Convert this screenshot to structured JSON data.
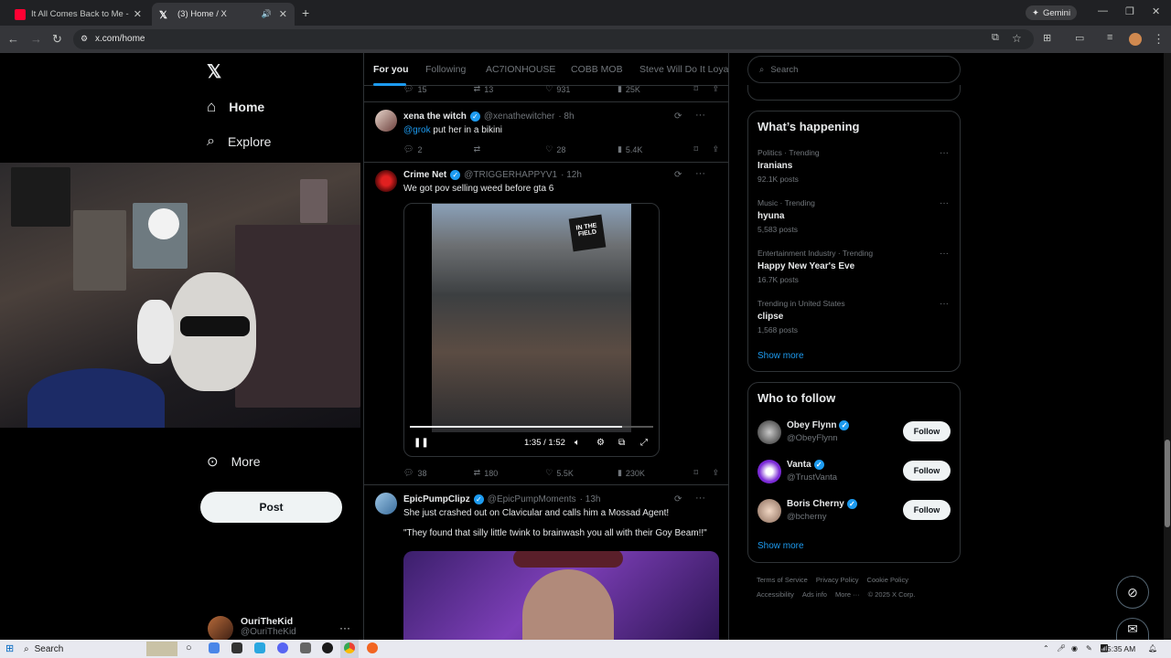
{
  "browser": {
    "tabs": [
      {
        "title": "It All Comes Back to Me - Baby",
        "icon": "youtube-icon"
      },
      {
        "title": "(3) Home / X",
        "icon": "x-icon"
      }
    ],
    "url": "x.com/home",
    "gemini_label": "Gemini"
  },
  "nav": {
    "home": "Home",
    "explore": "Explore",
    "more": "More",
    "post": "Post",
    "account_name": "OuriTheKid",
    "account_handle": "@OuriTheKid"
  },
  "feed": {
    "tabs": [
      "For you",
      "Following",
      "AC7IONHOUSE",
      "COBB MOB",
      "Steve Will Do It Loyal"
    ],
    "top_actions": {
      "replies": "15",
      "reposts": "13",
      "likes": "931",
      "views": "25K"
    },
    "tweets": [
      {
        "name": "xena the witch",
        "handle": "@xenathewitcher",
        "time": "· 8h",
        "mention": "@grok",
        "text": "put her in a bikini",
        "replies": "2",
        "reposts": "",
        "likes": "28",
        "views": "5.4K"
      },
      {
        "name": "Crime Net",
        "handle": "@TRIGGERHAPPYV1",
        "time": "· 12h",
        "text": "We got pov selling weed before gta 6",
        "video_time": "1:35 / 1:52",
        "video_badge_line1": "IN THE",
        "video_badge_line2": "FIELD",
        "replies": "38",
        "reposts": "180",
        "likes": "5.5K",
        "views": "230K"
      },
      {
        "name": "EpicPumpClipz",
        "handle": "@EpicPumpMoments",
        "time": "· 13h",
        "text": "She just crashed out on Clavicular and calls him a Mossad Agent!",
        "text2": "\"They found that silly little twink to brainwash you all with their Goy Beam!!\""
      }
    ]
  },
  "sidebar": {
    "search_placeholder": "Search",
    "whats_happening": "What’s happening",
    "trends": [
      {
        "meta": "Politics · Trending",
        "title": "Iranians",
        "count": "92.1K posts"
      },
      {
        "meta": "Music · Trending",
        "title": "hyuna",
        "count": "5,583 posts"
      },
      {
        "meta": "Entertainment Industry · Trending",
        "title": "Happy New Year's Eve",
        "count": "16.7K posts"
      },
      {
        "meta": "Trending in United States",
        "title": "clipse",
        "count": "1,568 posts"
      }
    ],
    "show_more": "Show more",
    "who_to_follow": "Who to follow",
    "follow_label": "Follow",
    "suggestions": [
      {
        "name": "Obey Flynn",
        "handle": "@ObeyFlynn"
      },
      {
        "name": "Vanta",
        "handle": "@TrustVanta"
      },
      {
        "name": "Boris Cherny",
        "handle": "@bcherny"
      }
    ],
    "footer": [
      "Terms of Service",
      "Privacy Policy",
      "Cookie Policy",
      "Accessibility",
      "Ads info",
      "More ···",
      "© 2025 X Corp."
    ]
  },
  "taskbar": {
    "search": "Search",
    "time": "5:35 AM"
  },
  "colors": {
    "accent": "#1d9bf0",
    "background": "#000000",
    "border": "#2f3336"
  }
}
